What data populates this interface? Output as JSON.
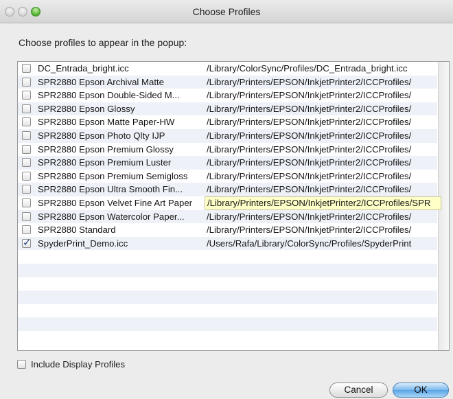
{
  "window": {
    "title": "Choose Profiles",
    "prompt": "Choose profiles to appear in the popup:"
  },
  "profiles": [
    {
      "name": "DC_Entrada_bright.icc",
      "path": "/Library/ColorSync/Profiles/DC_Entrada_bright.icc",
      "checked": false
    },
    {
      "name": "SPR2880 Epson Archival Matte",
      "path": "/Library/Printers/EPSON/InkjetPrinter2/ICCProfiles/",
      "checked": false
    },
    {
      "name": "SPR2880 Epson Double-Sided M...",
      "path": "/Library/Printers/EPSON/InkjetPrinter2/ICCProfiles/",
      "checked": false
    },
    {
      "name": "SPR2880 Epson Glossy",
      "path": "/Library/Printers/EPSON/InkjetPrinter2/ICCProfiles/",
      "checked": false
    },
    {
      "name": "SPR2880 Epson Matte Paper-HW",
      "path": "/Library/Printers/EPSON/InkjetPrinter2/ICCProfiles/",
      "checked": false
    },
    {
      "name": "SPR2880 Epson Photo Qlty IJP",
      "path": "/Library/Printers/EPSON/InkjetPrinter2/ICCProfiles/",
      "checked": false
    },
    {
      "name": "SPR2880 Epson Premium Glossy",
      "path": "/Library/Printers/EPSON/InkjetPrinter2/ICCProfiles/",
      "checked": false
    },
    {
      "name": "SPR2880 Epson Premium Luster",
      "path": "/Library/Printers/EPSON/InkjetPrinter2/ICCProfiles/",
      "checked": false
    },
    {
      "name": "SPR2880 Epson Premium Semigloss",
      "path": "/Library/Printers/EPSON/InkjetPrinter2/ICCProfiles/",
      "checked": false
    },
    {
      "name": "SPR2880 Epson Ultra Smooth Fin...",
      "path": "/Library/Printers/EPSON/InkjetPrinter2/ICCProfiles/",
      "checked": false
    },
    {
      "name": "SPR2880 Epson Velvet Fine Art Paper",
      "path": "/Library/Printers/EPSON/InkjetPrinter2/ICCProfiles/SPR",
      "checked": false
    },
    {
      "name": "SPR2880 Epson Watercolor Paper...",
      "path": "/Library/Printers/EPSON/InkjetPrinter2/ICCProfiles/",
      "checked": false
    },
    {
      "name": "SPR2880 Standard",
      "path": "/Library/Printers/EPSON/InkjetPrinter2/ICCProfiles/",
      "checked": false
    },
    {
      "name": "SpyderPrint_Demo.icc",
      "path": "/Users/Rafa/Library/ColorSync/Profiles/SpyderPrint",
      "checked": true
    }
  ],
  "include_display": {
    "label": "Include Display Profiles",
    "checked": false
  },
  "buttons": {
    "cancel": "Cancel",
    "ok": "OK"
  }
}
